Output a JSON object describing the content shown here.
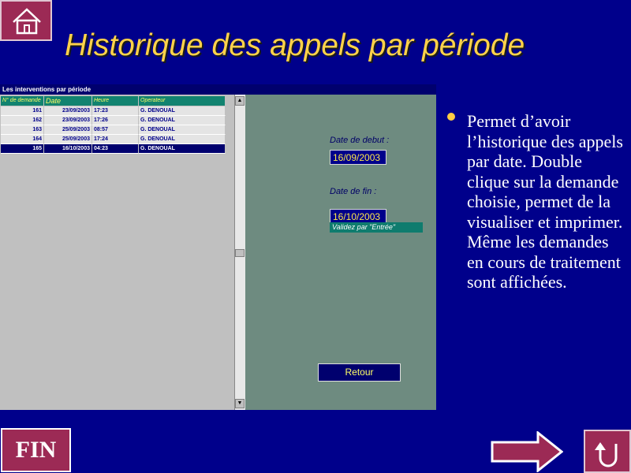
{
  "slide": {
    "title": "Historique des appels par période"
  },
  "window": {
    "title": "Les interventions par période"
  },
  "grid": {
    "columns": [
      "N° de demande",
      "Date",
      "Heure",
      "Operateur"
    ],
    "rows": [
      [
        "161",
        "23/09/2003",
        "17:23",
        "G. DENOUAL"
      ],
      [
        "162",
        "23/09/2003",
        "17:26",
        "G. DENOUAL"
      ],
      [
        "163",
        "25/09/2003",
        "08:57",
        "G. DENOUAL"
      ],
      [
        "164",
        "25/09/2003",
        "17:24",
        "G. DENOUAL"
      ],
      [
        "165",
        "16/10/2003",
        "04:23",
        "G. DENOUAL"
      ]
    ]
  },
  "form": {
    "start_label": "Date de debut :",
    "start_value": "16/09/2003",
    "end_label": "Date de fin :",
    "end_value": "16/10/2003",
    "hint": "Validez par \"Entrée\"",
    "retour": "Retour"
  },
  "description": "Permet d’avoir l’historique des appels par date. Double clique sur la demande choisie, permet de la visualiser et imprimer. Même les demandes en cours de traitement sont affichées.",
  "nav": {
    "fin": "FIN"
  },
  "colors": {
    "background": "#00008b",
    "title": "#ffd24a",
    "button": "#9c2a55",
    "grid_header": "#128370",
    "form_panel": "#6e8b80"
  },
  "icons": {
    "home": "home-icon",
    "next": "arrow-right-icon",
    "return": "return-icon"
  }
}
